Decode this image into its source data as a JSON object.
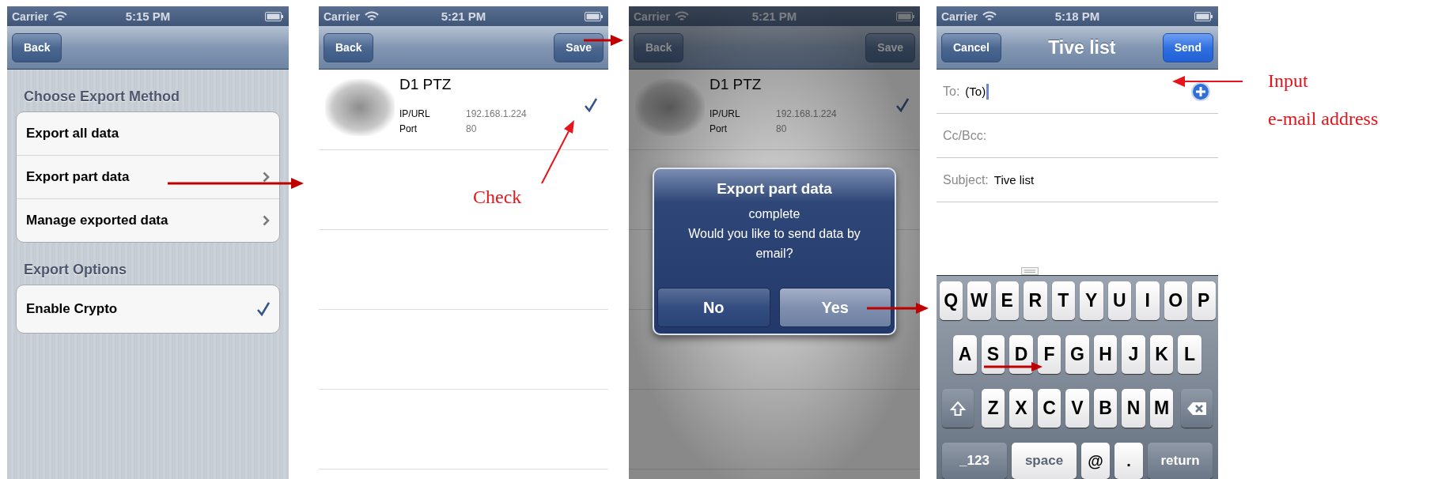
{
  "screens": [
    {
      "kind": "export_menu",
      "status_bar": {
        "carrier": "Carrier",
        "time": "5:15 PM"
      },
      "nav_bar": {
        "left_button": "Back"
      },
      "sections": [
        {
          "header": "Choose Export Method",
          "rows": [
            {
              "label": "Export all data",
              "disclosure": false,
              "checked": false
            },
            {
              "label": "Export part data",
              "disclosure": true,
              "checked": false
            },
            {
              "label": "Manage exported data",
              "disclosure": true,
              "checked": false
            }
          ]
        },
        {
          "header": "Export Options",
          "rows": [
            {
              "label": "Enable Crypto",
              "disclosure": false,
              "checked": true
            }
          ]
        }
      ]
    },
    {
      "kind": "device_list",
      "dimmed": false,
      "status_bar": {
        "carrier": "Carrier",
        "time": "5:21 PM"
      },
      "nav_bar": {
        "left_button": "Back",
        "right_button": "Save"
      },
      "devices": [
        {
          "name": "D1 PTZ",
          "fields": [
            {
              "label": "IP/URL",
              "value": "192.168.1.224"
            },
            {
              "label": "Port",
              "value": "80"
            }
          ],
          "checked": true
        }
      ]
    },
    {
      "kind": "device_list",
      "dimmed": true,
      "status_bar": {
        "carrier": "Carrier",
        "time": "5:21 PM"
      },
      "nav_bar": {
        "left_button": "Back",
        "right_button": "Save"
      },
      "devices": [
        {
          "name": "D1 PTZ",
          "fields": [
            {
              "label": "IP/URL",
              "value": "192.168.1.224"
            },
            {
              "label": "Port",
              "value": "80"
            }
          ],
          "checked": true
        }
      ],
      "alert": {
        "title": "Export part data",
        "message": "complete\nWould you like to send data by email?",
        "buttons": [
          "No",
          "Yes"
        ]
      }
    },
    {
      "kind": "mail_compose",
      "status_bar": {
        "carrier": "Carrier",
        "time": "5:18 PM"
      },
      "nav_bar": {
        "left_button": "Cancel",
        "title": "Tive list",
        "right_button": "Send"
      },
      "fields": [
        {
          "label": "To:",
          "value": "(To)",
          "focused": true
        },
        {
          "label": "Cc/Bcc:",
          "focused": false
        },
        {
          "label": "Subject:",
          "value": "Tive list",
          "focused": false
        }
      ],
      "keyboard": {
        "rows": [
          [
            "Q",
            "W",
            "E",
            "R",
            "T",
            "Y",
            "U",
            "I",
            "O",
            "P"
          ],
          [
            "A",
            "S",
            "D",
            "F",
            "G",
            "H",
            "J",
            "K",
            "L"
          ],
          [
            "Z",
            "X",
            "C",
            "V",
            "B",
            "N",
            "M"
          ]
        ],
        "bottom_row": [
          "_123",
          "space",
          "@",
          ".",
          "return"
        ]
      }
    }
  ],
  "annotations": {
    "check": "Check",
    "input": [
      "Input",
      "e-mail address"
    ]
  }
}
